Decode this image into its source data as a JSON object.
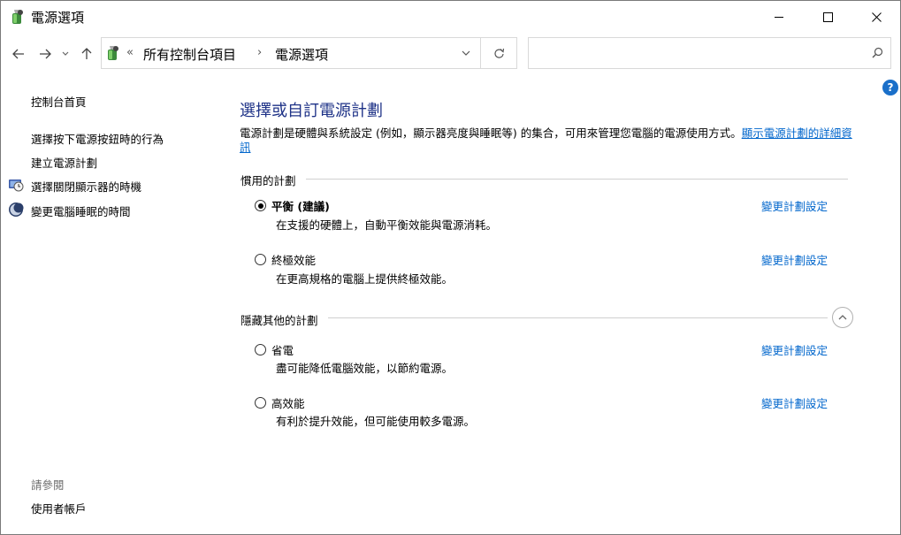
{
  "window": {
    "title": "電源選項"
  },
  "title_buttons": {
    "minimize": "minimize-icon",
    "maximize": "maximize-icon",
    "close": "close-icon"
  },
  "address": {
    "overflow": "«",
    "crumbs": [
      "所有控制台項目",
      "電源選項"
    ],
    "separator": "›"
  },
  "search": {
    "value": "",
    "placeholder": ""
  },
  "sidebar": {
    "home": "控制台首頁",
    "links": [
      "選擇按下電源按鈕時的行為",
      "建立電源計劃",
      "選擇關閉顯示器的時機",
      "變更電腦睡眠的時間"
    ],
    "see_also_label": "請參閱",
    "see_also": [
      "使用者帳戶"
    ]
  },
  "main": {
    "heading": "選擇或自訂電源計劃",
    "description": "電源計劃是硬體與系統設定 (例如，顯示器亮度與睡眠等) 的集合，可用來管理您電腦的電源使用方式。",
    "description_link": "顯示電源計劃的詳細資訊",
    "preferred_label": "慣用的計劃",
    "hidden_label": "隱藏其他的計劃",
    "change_link": "變更計劃設定",
    "preferred_plans": [
      {
        "name": "平衡 (建議)",
        "desc": "在支援的硬體上，自動平衡效能與電源消耗。",
        "selected": true
      },
      {
        "name": "終極效能",
        "desc": "在更高規格的電腦上提供終極效能。",
        "selected": false
      }
    ],
    "hidden_plans": [
      {
        "name": "省電",
        "desc": "盡可能降低電腦效能，以節約電源。",
        "selected": false
      },
      {
        "name": "高效能",
        "desc": "有利於提升效能，但可能使用較多電源。",
        "selected": false
      }
    ]
  },
  "colors": {
    "heading": "#1e3287",
    "link": "#0066cc",
    "help": "#1a6fc9"
  }
}
